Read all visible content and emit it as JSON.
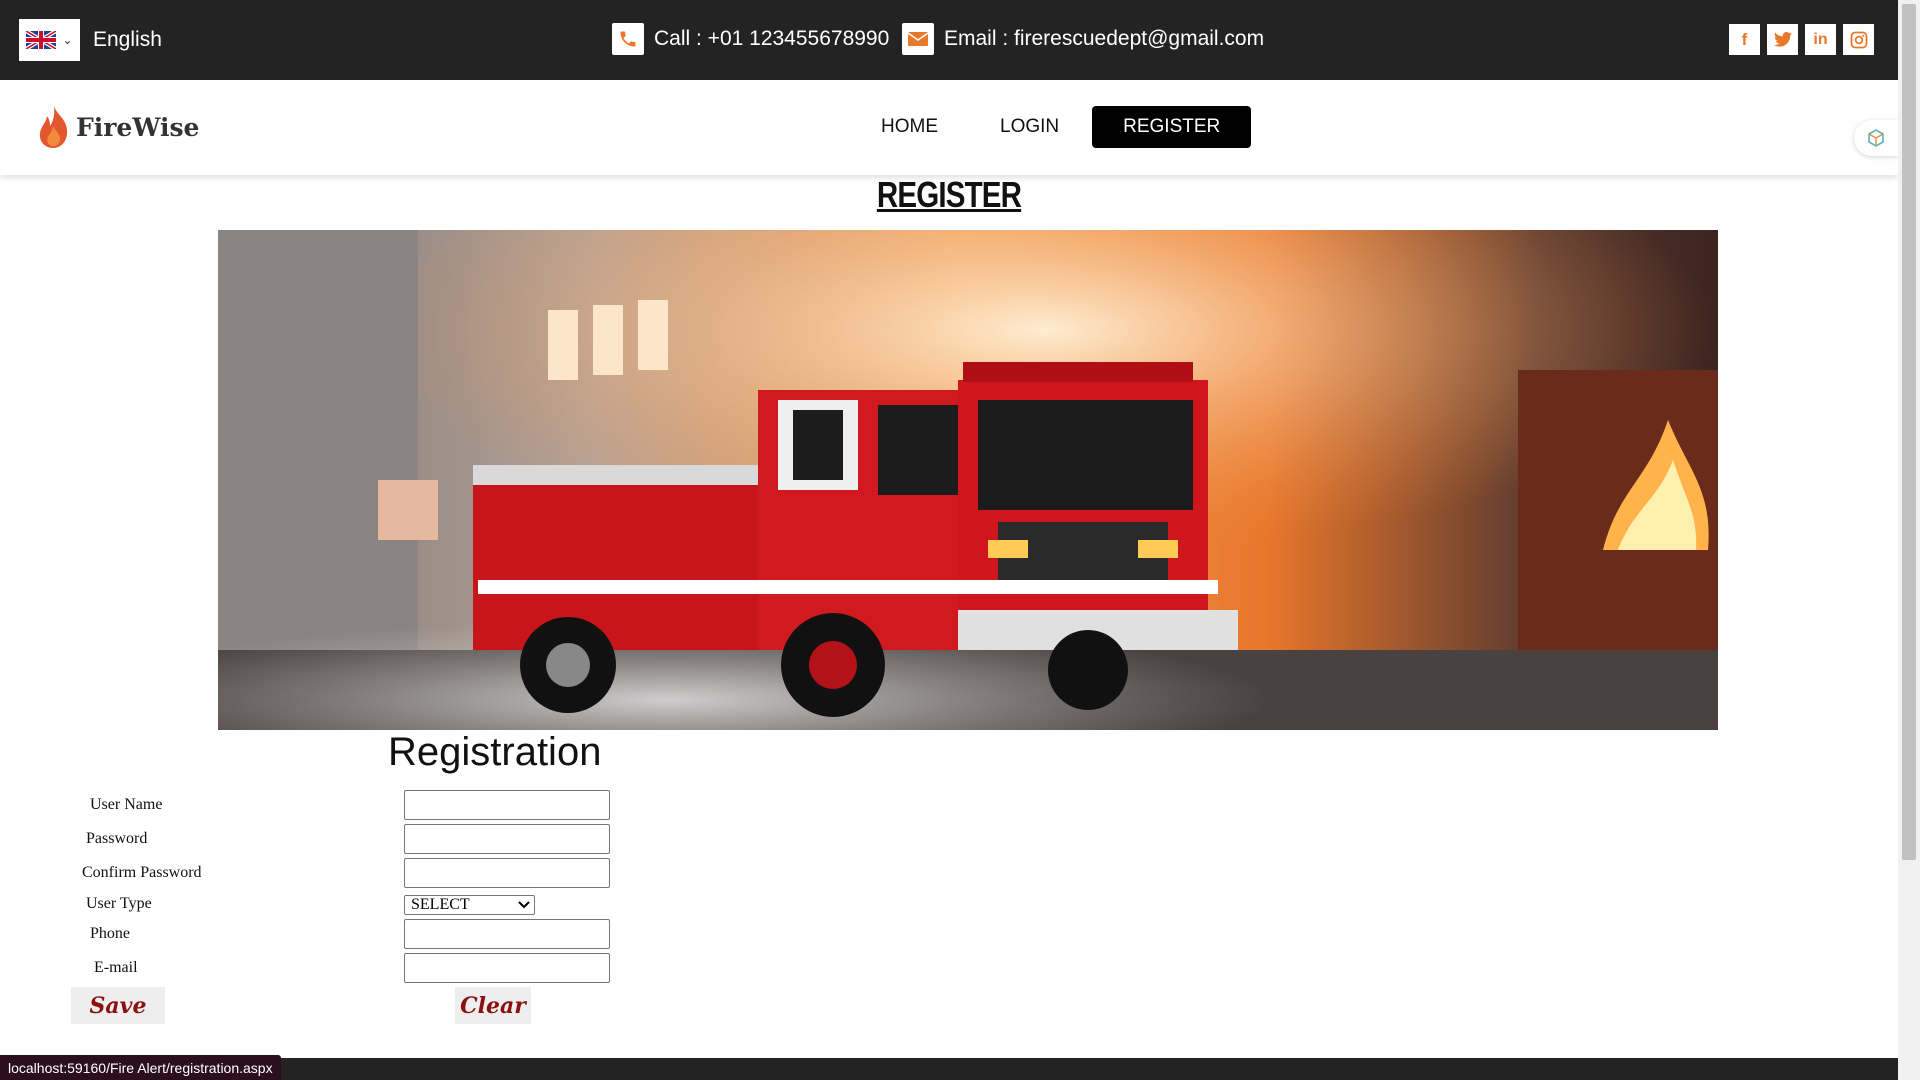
{
  "topbar": {
    "language": "English",
    "call": "Call : +01 123455678990",
    "email": "Email : firerescuedept@gmail.com",
    "socials": [
      "facebook-icon",
      "twitter-icon",
      "linkedin-icon",
      "instagram-icon"
    ],
    "accent": "#e8782a"
  },
  "header": {
    "brand": "FireWise",
    "nav": {
      "home": "HOME",
      "login": "LOGIN",
      "register": "REGISTER"
    }
  },
  "page": {
    "title": "REGISTER"
  },
  "form": {
    "heading": "Registration",
    "labels": {
      "username": "User Name",
      "password": "Password",
      "confirm": "Confirm Password",
      "usertype": "User Type",
      "phone": "Phone",
      "email": "E-mail"
    },
    "usertype_selected": "SELECT",
    "save": "Save",
    "clear": "Clear"
  },
  "status": {
    "url": "localhost:59160/Fire Alert/registration.aspx"
  }
}
